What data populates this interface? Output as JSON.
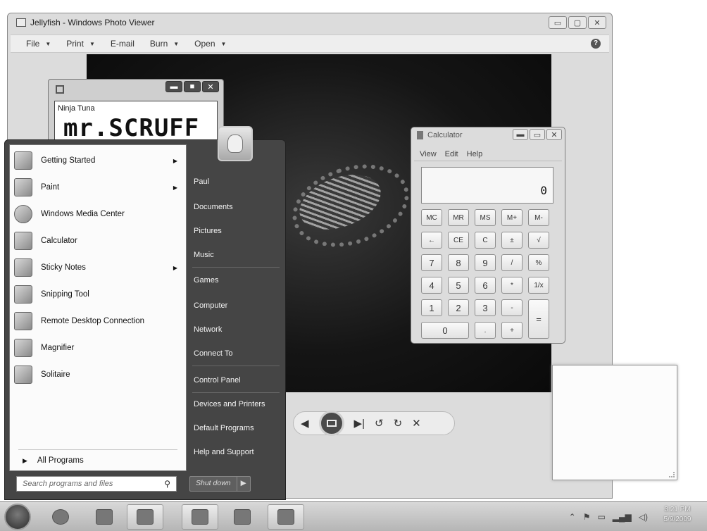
{
  "photo_viewer": {
    "title": "Jellyfish - Windows Photo Viewer",
    "menu": [
      {
        "label": "File",
        "has_arrow": true
      },
      {
        "label": "Print",
        "has_arrow": true
      },
      {
        "label": "E-mail",
        "has_arrow": false
      },
      {
        "label": "Burn",
        "has_arrow": true
      },
      {
        "label": "Open",
        "has_arrow": true
      }
    ],
    "help_label": "?",
    "controls": {
      "prev": "◀",
      "next": "▶|",
      "rotate_left": "↺",
      "rotate_right": "↻",
      "delete": "✕"
    }
  },
  "media_player": {
    "artist": "Ninja Tuna",
    "album_art_text": "mr.SCRUFF"
  },
  "calculator": {
    "title": "Calculator",
    "menu": [
      "View",
      "Edit",
      "Help"
    ],
    "display": "0",
    "keys": {
      "mc": "MC",
      "mr": "MR",
      "ms": "MS",
      "mplus": "M+",
      "mminus": "M-",
      "back": "←",
      "ce": "CE",
      "c": "C",
      "sign": "±",
      "sqrt": "√",
      "k7": "7",
      "k8": "8",
      "k9": "9",
      "div": "/",
      "pct": "%",
      "k4": "4",
      "k5": "5",
      "k6": "6",
      "mul": "*",
      "recip": "1/x",
      "k1": "1",
      "k2": "2",
      "k3": "3",
      "sub": "-",
      "eq": "=",
      "k0": "0",
      "dot": ".",
      "add": "+"
    }
  },
  "start_menu": {
    "programs": [
      {
        "label": "Getting Started",
        "submenu": true
      },
      {
        "label": "Paint",
        "submenu": true
      },
      {
        "label": "Windows Media Center",
        "submenu": false
      },
      {
        "label": "Calculator",
        "submenu": false
      },
      {
        "label": "Sticky Notes",
        "submenu": true
      },
      {
        "label": "Snipping Tool",
        "submenu": false
      },
      {
        "label": "Remote Desktop Connection",
        "submenu": false
      },
      {
        "label": "Magnifier",
        "submenu": false
      },
      {
        "label": "Solitaire",
        "submenu": false
      }
    ],
    "all_programs": "All Programs",
    "search_placeholder": "Search programs and files",
    "right_items": [
      "Paul",
      "Documents",
      "Pictures",
      "Music",
      "Games",
      "Computer",
      "Network",
      "Connect To",
      "Control Panel",
      "Devices and Printers",
      "Default Programs",
      "Help and Support"
    ],
    "shutdown_label": "Shut down"
  },
  "taskbar": {
    "clock_time": "3:21 PM",
    "clock_date": "5/9/2009"
  }
}
